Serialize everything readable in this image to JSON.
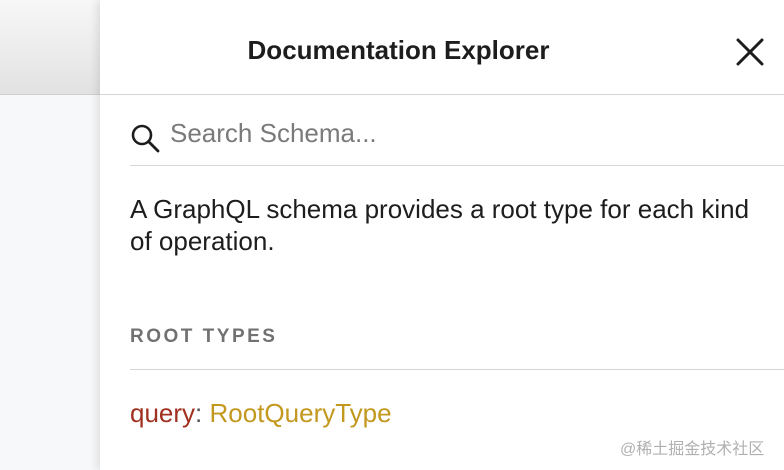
{
  "panel": {
    "title": "Documentation Explorer",
    "close_icon": "close-icon"
  },
  "search": {
    "placeholder": "Search Schema...",
    "value": "",
    "icon": "search-icon"
  },
  "description": "A GraphQL schema provides a root type for each kind of operation.",
  "root_types": {
    "title": "ROOT TYPES",
    "items": [
      {
        "name": "query",
        "separator": ": ",
        "type": "RootQueryType"
      }
    ]
  },
  "watermark": "@稀土掘金技术社区",
  "colors": {
    "field_name": "#a0301f",
    "type_name": "#c2981f",
    "section_title": "#717171"
  }
}
